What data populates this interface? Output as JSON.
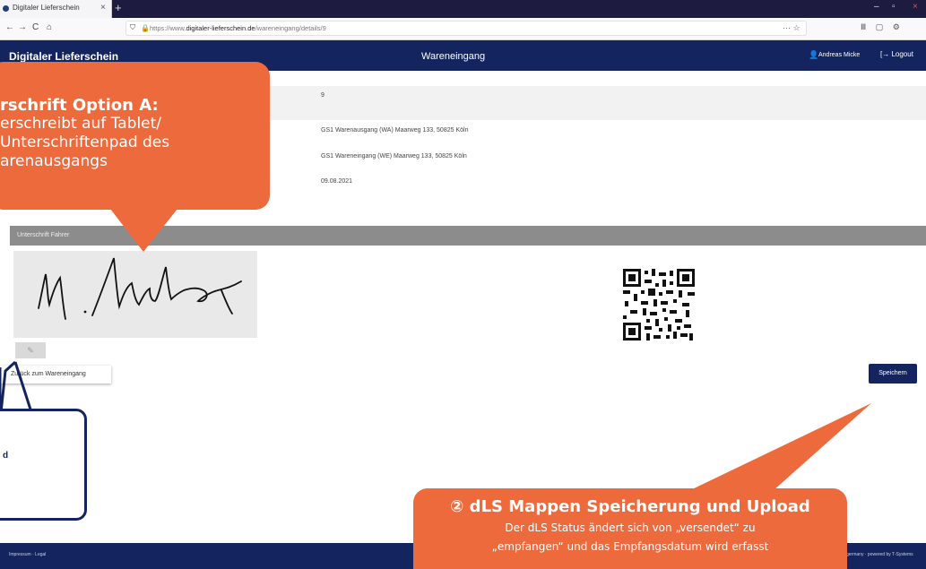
{
  "browser": {
    "tab_title": "Digitaler Lieferschein",
    "tab_close": "×",
    "new_tab": "+",
    "url_prefix": "https://www.",
    "url_domain": "digitaler-lieferschein.de",
    "url_path": "/wareneingang/details/9",
    "url_end_icons": "··· ☆",
    "toolbar_icons": "Ⅲ ▢ ⚙",
    "back": "←",
    "forward": "→",
    "reload": "C",
    "home": "⌂",
    "win_min": "–",
    "win_max": "▫",
    "win_close": "×"
  },
  "app": {
    "brand": "Digitaler Lieferschein",
    "page_title": "Wareneingang",
    "user_name": "Andreas Micke",
    "logout": "Logout"
  },
  "details": {
    "value_1": "9",
    "value_2": "GS1 Warenausgang (WA) Maarweg 133, 50825 Köln",
    "value_3": "GS1 Wareneingang (WE) Maarweg 133, 50825 Köln",
    "value_4": "09.08.2021"
  },
  "signature": {
    "section_title": "Unterschrift Fahrer",
    "clear_icon": "✎"
  },
  "buttons": {
    "back_label": "Zurück zum Wareneingang",
    "save_label": "Speichern"
  },
  "footer": {
    "left": "Impressum · Legal",
    "right": "germany · powered by T-Systems"
  },
  "callouts": {
    "signature_heading": "rschrift Option A:",
    "signature_body_1": "erschreibt auf Tablet/",
    "signature_body_2": " Unterschriftenpad des",
    "signature_body_3": "arenausgangs",
    "save_heading": "② dLS Mappen Speicherung und Upload",
    "save_body_1": "Der dLS Status ändert sich von „versendet“ zu",
    "save_body_2": "„empfangen“ und das Empfangsdatum wird erfasst",
    "left_text": "d"
  },
  "colors": {
    "accent_navy": "#14245e",
    "callout_orange": "#ec6a3c"
  }
}
